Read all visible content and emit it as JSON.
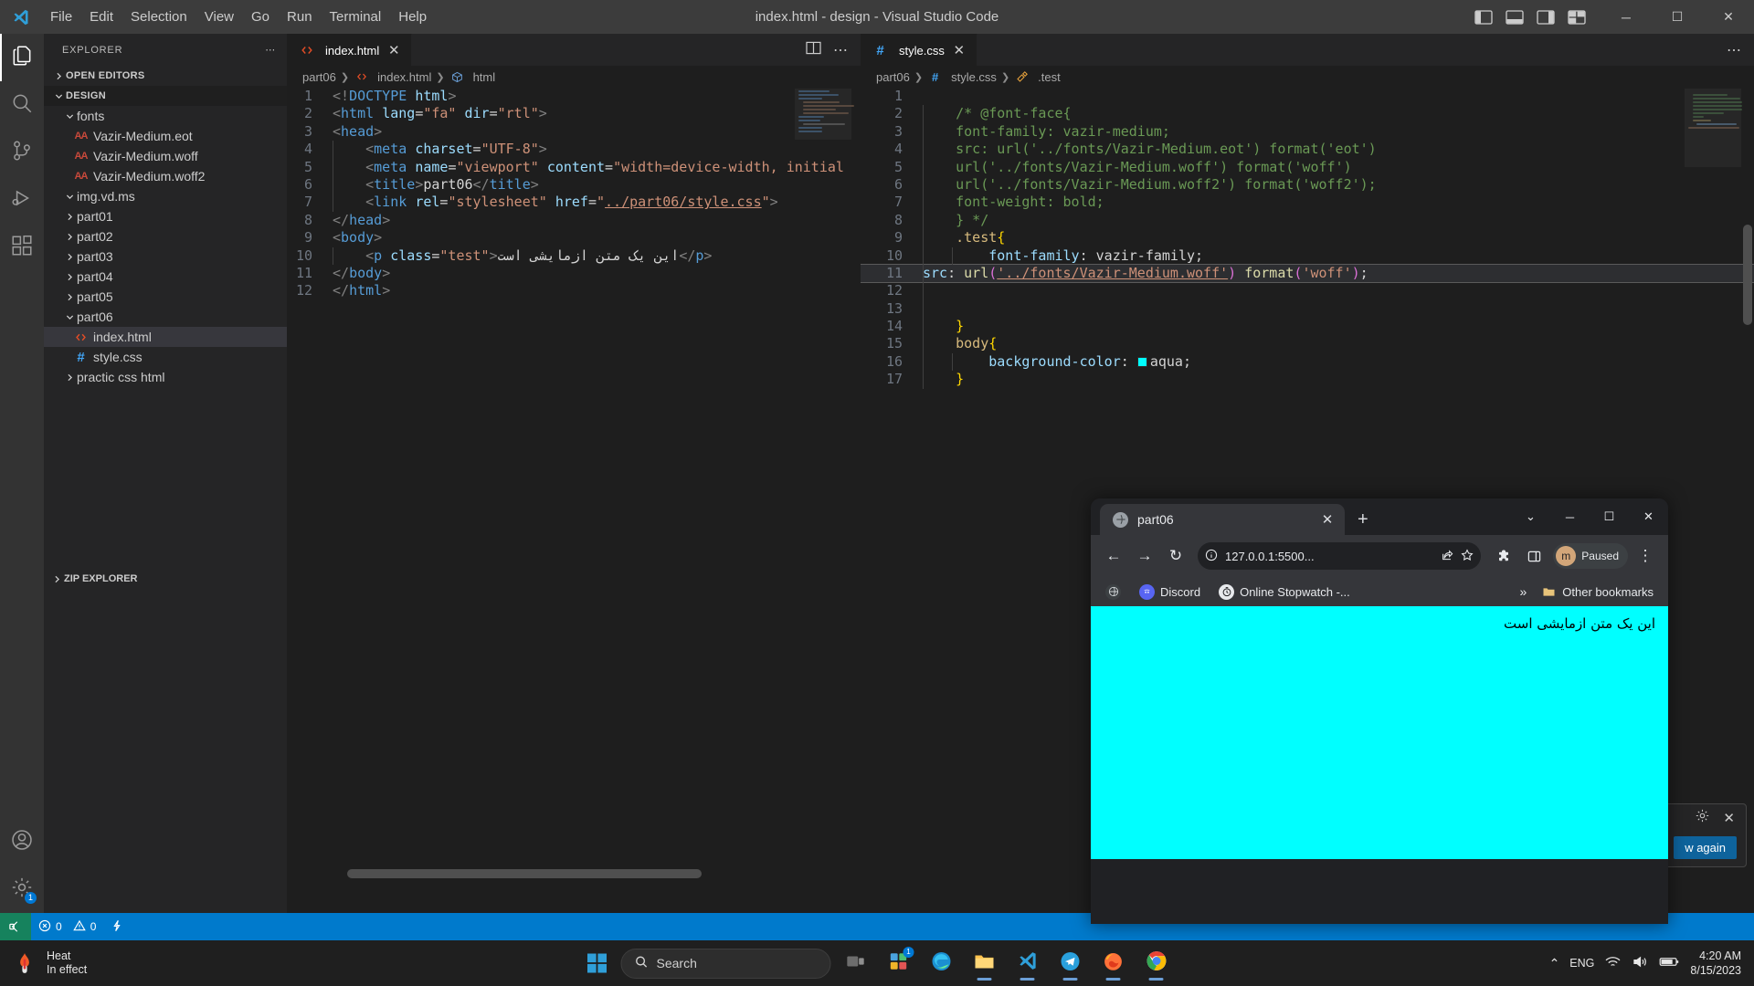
{
  "window": {
    "title": "index.html - design - Visual Studio Code",
    "menu": [
      "File",
      "Edit",
      "Selection",
      "View",
      "Go",
      "Run",
      "Terminal",
      "Help"
    ],
    "controls": {
      "minimize": "─",
      "maximize": "☐",
      "close": "✕"
    },
    "layout_icons": [
      "panel-left-icon",
      "panel-bottom-icon",
      "panel-right-icon",
      "layout-grid-icon"
    ]
  },
  "activitybar": {
    "items": [
      {
        "name": "explorer",
        "icon": "files-icon",
        "active": true
      },
      {
        "name": "search",
        "icon": "search-icon",
        "active": false
      },
      {
        "name": "source-control",
        "icon": "source-control-icon",
        "active": false
      },
      {
        "name": "run-and-debug",
        "icon": "run-debug-icon",
        "active": false
      },
      {
        "name": "extensions",
        "icon": "extensions-icon",
        "active": false
      }
    ],
    "bottom": [
      {
        "name": "accounts",
        "icon": "account-icon"
      },
      {
        "name": "settings",
        "icon": "gear-icon",
        "badge": "1"
      }
    ]
  },
  "sidebar": {
    "header": "EXPLORER",
    "more_actions": "⋯",
    "sections": [
      {
        "label": "OPEN EDITORS",
        "expanded": false
      },
      {
        "label": "DESIGN",
        "expanded": true
      }
    ],
    "zip_explorer": "ZIP EXPLORER",
    "tree": [
      {
        "label": "fonts",
        "type": "folder",
        "expanded": true,
        "depth": 1
      },
      {
        "label": "Vazir-Medium.eot",
        "type": "font",
        "depth": 2
      },
      {
        "label": "Vazir-Medium.woff",
        "type": "font",
        "depth": 2
      },
      {
        "label": "Vazir-Medium.woff2",
        "type": "font",
        "depth": 2
      },
      {
        "label": "img.vd.ms",
        "type": "folder",
        "expanded": true,
        "depth": 1
      },
      {
        "label": "part01",
        "type": "folder",
        "expanded": false,
        "depth": 1
      },
      {
        "label": "part02",
        "type": "folder",
        "expanded": false,
        "depth": 1
      },
      {
        "label": "part03",
        "type": "folder",
        "expanded": false,
        "depth": 1
      },
      {
        "label": "part04",
        "type": "folder",
        "expanded": false,
        "depth": 1
      },
      {
        "label": "part05",
        "type": "folder",
        "expanded": false,
        "depth": 1
      },
      {
        "label": "part06",
        "type": "folder",
        "expanded": true,
        "depth": 1
      },
      {
        "label": "index.html",
        "type": "html",
        "depth": 2,
        "selected": true
      },
      {
        "label": "style.css",
        "type": "css",
        "depth": 2
      },
      {
        "label": "practic css html",
        "type": "folder",
        "expanded": false,
        "depth": 1
      }
    ]
  },
  "editor_left": {
    "tab": {
      "label": "index.html",
      "icon": "html-icon",
      "close": "✕"
    },
    "actions": [
      "split-editor-icon",
      "more-actions-icon"
    ],
    "breadcrumb": [
      "part06",
      "index.html",
      "html"
    ],
    "lines": [
      {
        "n": "1",
        "html": "<span class=\"t-br\">&lt;!</span><span class=\"t-tag\">DOCTYPE</span> <span class=\"t-attr\">html</span><span class=\"t-br\">&gt;</span>"
      },
      {
        "n": "2",
        "html": "<span class=\"t-br\">&lt;</span><span class=\"t-tag\">html</span> <span class=\"t-attr\">lang</span><span class=\"t-punc\">=</span><span class=\"t-str\">\"fa\"</span> <span class=\"t-attr\">dir</span><span class=\"t-punc\">=</span><span class=\"t-str\">\"rtl\"</span><span class=\"t-br\">&gt;</span>"
      },
      {
        "n": "3",
        "html": "<span class=\"t-br\">&lt;</span><span class=\"t-tag\">head</span><span class=\"t-br\">&gt;</span>"
      },
      {
        "n": "4",
        "html": "    <span class=\"t-br\">&lt;</span><span class=\"t-tag\">meta</span> <span class=\"t-attr\">charset</span><span class=\"t-punc\">=</span><span class=\"t-str\">\"UTF-8\"</span><span class=\"t-br\">&gt;</span>"
      },
      {
        "n": "5",
        "html": "    <span class=\"t-br\">&lt;</span><span class=\"t-tag\">meta</span> <span class=\"t-attr\">name</span><span class=\"t-punc\">=</span><span class=\"t-str\">\"viewport\"</span> <span class=\"t-attr\">content</span><span class=\"t-punc\">=</span><span class=\"t-str\">\"width=device-width, initial</span>"
      },
      {
        "n": "6",
        "html": "    <span class=\"t-br\">&lt;</span><span class=\"t-tag\">title</span><span class=\"t-br\">&gt;</span><span class=\"t-txt\">part06</span><span class=\"t-br\">&lt;/</span><span class=\"t-tag\">title</span><span class=\"t-br\">&gt;</span>"
      },
      {
        "n": "7",
        "html": "    <span class=\"t-br\">&lt;</span><span class=\"t-tag\">link</span> <span class=\"t-attr\">rel</span><span class=\"t-punc\">=</span><span class=\"t-str\">\"stylesheet\"</span> <span class=\"t-attr\">href</span><span class=\"t-punc\">=</span><span class=\"t-str\">\"</span><span class=\"t-str link-u\">../part06/style.css</span><span class=\"t-str\">\"</span><span class=\"t-br\">&gt;</span>"
      },
      {
        "n": "8",
        "html": "<span class=\"t-br\">&lt;/</span><span class=\"t-tag\">head</span><span class=\"t-br\">&gt;</span>"
      },
      {
        "n": "9",
        "html": "<span class=\"t-br\">&lt;</span><span class=\"t-tag\">body</span><span class=\"t-br\">&gt;</span>"
      },
      {
        "n": "10",
        "html": "    <span class=\"t-br\">&lt;</span><span class=\"t-tag\">p</span> <span class=\"t-attr\">class</span><span class=\"t-punc\">=</span><span class=\"t-str\">\"test\"</span><span class=\"t-br\">&gt;</span><span class=\"t-txt\" dir=\"rtl\">این یک متن ازمایشی است</span><span class=\"t-br\">&lt;/</span><span class=\"t-tag\">p</span><span class=\"t-br\">&gt;</span>"
      },
      {
        "n": "11",
        "html": "<span class=\"t-br\">&lt;/</span><span class=\"t-tag\">body</span><span class=\"t-br\">&gt;</span>"
      },
      {
        "n": "12",
        "html": "<span class=\"t-br\">&lt;/</span><span class=\"t-tag\">html</span><span class=\"t-br\">&gt;</span>"
      }
    ]
  },
  "editor_right": {
    "tab": {
      "label": "style.css",
      "icon": "css-icon",
      "close": "✕"
    },
    "actions": [
      "more-actions-icon"
    ],
    "breadcrumb": [
      "part06",
      "style.css",
      ".test"
    ],
    "lines": [
      {
        "n": "1",
        "html": ""
      },
      {
        "n": "2",
        "html": "    <span class=\"t-com\">/* @font-face{</span>"
      },
      {
        "n": "3",
        "html": "    <span class=\"t-com\">font-family: vazir-medium;</span>"
      },
      {
        "n": "4",
        "html": "    <span class=\"t-com\">src: url('../fonts/Vazir-Medium.eot') format('eot')</span>"
      },
      {
        "n": "5",
        "html": "    <span class=\"t-com\">url('../fonts/Vazir-Medium.woff') format('woff')</span>"
      },
      {
        "n": "6",
        "html": "    <span class=\"t-com\">url('../fonts/Vazir-Medium.woff2') format('woff2');</span>"
      },
      {
        "n": "7",
        "html": "    <span class=\"t-com\">font-weight: bold;</span>"
      },
      {
        "n": "8",
        "html": "    <span class=\"t-com\">} */</span>"
      },
      {
        "n": "9",
        "html": "    <span class=\"t-sel\">.test</span><span class=\"t-curly\">{</span>"
      },
      {
        "n": "10",
        "html": "        <span class=\"t-prop\">font-family</span><span class=\"t-punc\">:</span> <span class=\"t-txt\">vazir-family</span><span class=\"t-punc\">;</span>"
      },
      {
        "n": "11",
        "html": "<span class=\"t-prop\">src</span><span class=\"t-punc\">:</span> <span class=\"t-func\">url</span><span class=\"t-pink\">(</span><span class=\"t-str link-u\">'../fonts/Vazir-Medium.woff'</span><span class=\"t-pink\">)</span> <span class=\"t-func\">format</span><span class=\"t-pink\">(</span><span class=\"t-str\">'woff'</span><span class=\"t-pink\">)</span><span class=\"t-punc\">;</span>"
      },
      {
        "n": "12",
        "html": ""
      },
      {
        "n": "13",
        "html": ""
      },
      {
        "n": "14",
        "html": "    <span class=\"t-curly\">}</span>"
      },
      {
        "n": "15",
        "html": "    <span class=\"t-sel\">body</span><span class=\"t-curly\">{</span>"
      },
      {
        "n": "16",
        "html": "        <span class=\"t-prop\">background-color</span><span class=\"t-punc\">:</span> <span class=\"colorbox\"></span><span class=\"t-txt\">aqua</span><span class=\"t-punc\">;</span>"
      },
      {
        "n": "17",
        "html": "    <span class=\"t-curly\">}</span>"
      }
    ]
  },
  "statusbar": {
    "remote_icon": "remote-window-icon",
    "errors": "0",
    "warnings": "0",
    "errors_icon": "error-icon",
    "warnings_icon": "warning-icon",
    "ports_icon": "ports-icon"
  },
  "notification": {
    "gear_icon": "gear-icon",
    "close_icon": "close-icon",
    "button_label": "w again"
  },
  "chrome": {
    "tab": {
      "title": "part06",
      "favicon": "globe-icon",
      "close": "✕"
    },
    "new_tab": "+",
    "window_controls": {
      "minimize_more": "⌄",
      "minimize": "─",
      "maximize": "☐",
      "close": "✕"
    },
    "toolbar": {
      "back": "←",
      "forward": "→",
      "reload": "↻",
      "site_info_icon": "info-icon",
      "url": "127.0.0.1:5500...",
      "share_icon": "share-icon",
      "bookmark_icon": "star-icon",
      "extensions_icon": "puzzle-icon",
      "sidepanel_icon": "side-panel-icon",
      "profile_initial": "m",
      "profile_label": "Paused",
      "menu_icon": "kebab-menu-icon"
    },
    "bookmarks": {
      "apps_icon": "apps-globe-icon",
      "items": [
        {
          "label": "Discord",
          "icon": "discord-icon",
          "color": "#5865f2"
        },
        {
          "label": "Online Stopwatch -...",
          "icon": "stopwatch-icon",
          "color": "#3b3b3b"
        }
      ],
      "overflow": "»",
      "other_bookmarks": "Other bookmarks",
      "other_icon": "folder-icon"
    },
    "page": {
      "text": "این یک متن ازمایشی است",
      "background_color": "#00ffff"
    }
  },
  "taskbar": {
    "weather": {
      "title": "Heat",
      "subtitle": "In effect",
      "icon": "heat-warning-icon"
    },
    "start_icon": "windows-start-icon",
    "search_placeholder": "Search",
    "search_icon": "search-icon",
    "apps": [
      {
        "name": "task-view",
        "icon": "task-view-icon",
        "running": false
      },
      {
        "name": "widgets",
        "icon": "widgets-icon",
        "running": false,
        "badge": "1"
      },
      {
        "name": "microsoft-edge",
        "icon": "edge-icon",
        "running": false
      },
      {
        "name": "file-explorer",
        "icon": "folder-icon",
        "running": true
      },
      {
        "name": "visual-studio-code",
        "icon": "vscode-icon",
        "running": true
      },
      {
        "name": "telegram",
        "icon": "telegram-icon",
        "running": true
      },
      {
        "name": "firefox",
        "icon": "firefox-icon",
        "running": true
      },
      {
        "name": "google-chrome",
        "icon": "chrome-icon",
        "running": true
      }
    ],
    "tray": {
      "chevron": "⌃",
      "language": "ENG",
      "wifi_icon": "wifi-icon",
      "volume_icon": "volume-icon",
      "battery_icon": "battery-icon",
      "time": "4:20 AM",
      "date": "8/15/2023"
    }
  }
}
